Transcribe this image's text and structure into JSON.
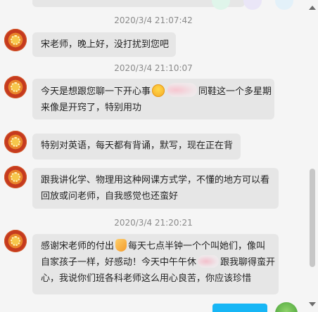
{
  "messages": [
    {
      "timestamp": "2020/3/4 21:07:42",
      "lines": [
        "宋老师，晚上好，没打扰到您吧"
      ]
    },
    {
      "timestamp": "2020/3/4 21:10:07",
      "parts": {
        "l1a": "今天是想跟您聊一下开心事",
        "l1b": "同鞋这一个多星期",
        "l2": "来像是开窍了，特别用功"
      }
    },
    {
      "lines": [
        "特别对英语，每天都有背诵，默写，现在正在背"
      ]
    },
    {
      "lines": [
        "跟我讲化学、物理用这种网课方式学，不懂的地方可以看",
        "回放或问老师，自我感觉也还蛮好"
      ]
    },
    {
      "timestamp": "2020/3/4 21:20:21",
      "parts": {
        "l1a": "感谢宋老师的付出",
        "l1b": "每天七点半钟一个个叫她们，像叫",
        "l2a": "自家孩子一样，好感动！今天中午午休",
        "l2b": "跟我聊得蛮开",
        "l3": "心，我说你们班各科老师这么用心良苦，你应该珍惜"
      }
    }
  ],
  "icons": {
    "avatar": "sunflower-avatar",
    "emoji_1": "grinning-face-icon",
    "emoji_2": "folded-hands-icon"
  },
  "colors": {
    "bubble": "#e6e6e6",
    "outgoing": "#17b6f5",
    "background": "#f5f5f5"
  }
}
